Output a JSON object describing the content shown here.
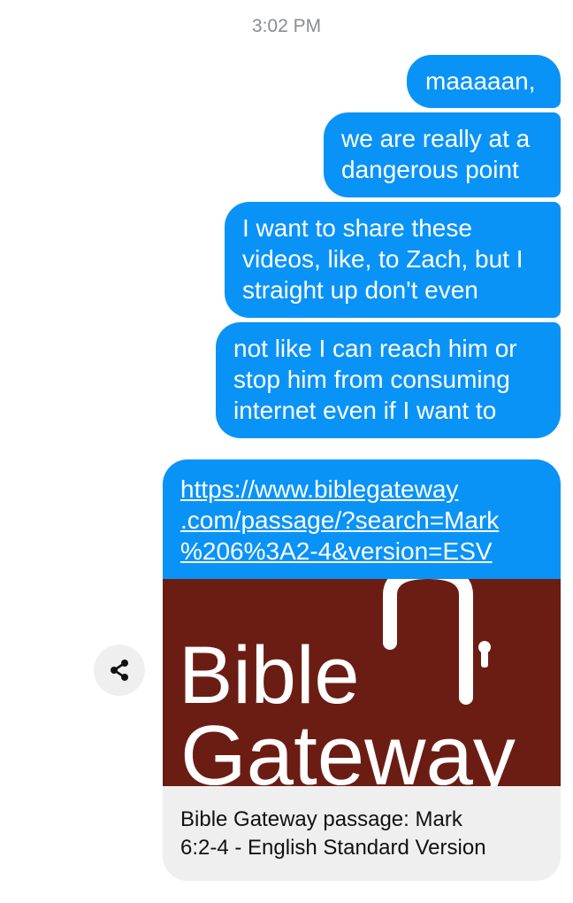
{
  "timestamp": "3:02 PM",
  "messages": [
    {
      "text": "maaaaan,"
    },
    {
      "text": "we are really at a\ndangerous point"
    },
    {
      "text": "I want to share these\nvideos, like, to Zach, but I\nstraight up don't even"
    },
    {
      "text": "not like I can reach him or\nstop him from consuming\ninternet even if I want to"
    }
  ],
  "link": {
    "url_lines": [
      "https://www.biblegateway",
      ".com/passage/?search=Mark",
      "%206%3A2-4&version=ESV"
    ],
    "logo_line1": "Bible",
    "logo_line2": "Gateway",
    "caption_lines": [
      "Bible Gateway passage: Mark",
      "6:2-4 - English Standard Version"
    ]
  },
  "colors": {
    "bubble": "#0a93f7",
    "logo_background": "#6b1d14"
  },
  "icons": {
    "share": "share-icon"
  }
}
